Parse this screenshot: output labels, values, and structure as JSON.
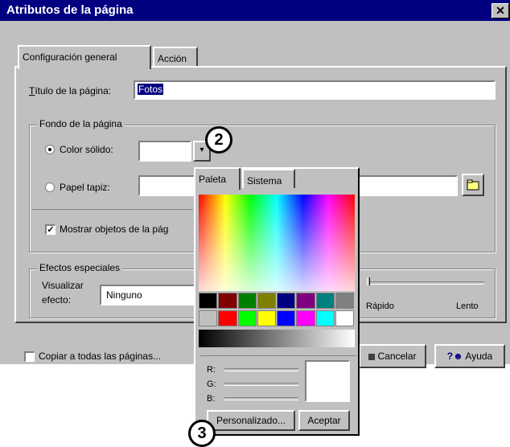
{
  "window": {
    "title": "Atributos de la página",
    "close": "✕"
  },
  "tabs": [
    {
      "label": "Configuración general"
    },
    {
      "label": "Acción"
    }
  ],
  "title_field": {
    "label": "Título de la página:",
    "value": "Fotos"
  },
  "background_group": {
    "label": "Fondo de la página",
    "solid_color_label": "Color sólido:",
    "wallpaper_label": "Papel tapiz:",
    "show_objects_label": "Mostrar objetos de la pág"
  },
  "effects_group": {
    "label": "Efectos especiales",
    "visualize_label_1": "Visualizar",
    "visualize_label_2": "efecto:",
    "effect_value": "Ninguno",
    "speed_fast": "Rápido",
    "speed_slow": "Lento"
  },
  "footer": {
    "copy_all_label": "Copiar a todas las páginas...",
    "cancel_button": "Cancelar",
    "help_button": "Ayuda"
  },
  "color_popup": {
    "tabs": [
      {
        "label": "Paleta"
      },
      {
        "label": "Sistema"
      }
    ],
    "rgb_labels": {
      "r": "R:",
      "g": "G:",
      "b": "B:"
    },
    "custom_button": "Personalizado...",
    "accept_button": "Aceptar",
    "swatches_row1": [
      "#000000",
      "#800000",
      "#008000",
      "#808000",
      "#000080",
      "#800080",
      "#008080",
      "#808080"
    ],
    "swatches_row2": [
      "#c0c0c0",
      "#ff0000",
      "#00ff00",
      "#ffff00",
      "#0000ff",
      "#ff00ff",
      "#00ffff",
      "#ffffff"
    ]
  },
  "callouts": {
    "dropdown_callout": "2",
    "custom_callout": "3"
  },
  "colors": {
    "titlebar": "#000080",
    "dialog": "#c0c0c0",
    "selection": "#000080"
  }
}
